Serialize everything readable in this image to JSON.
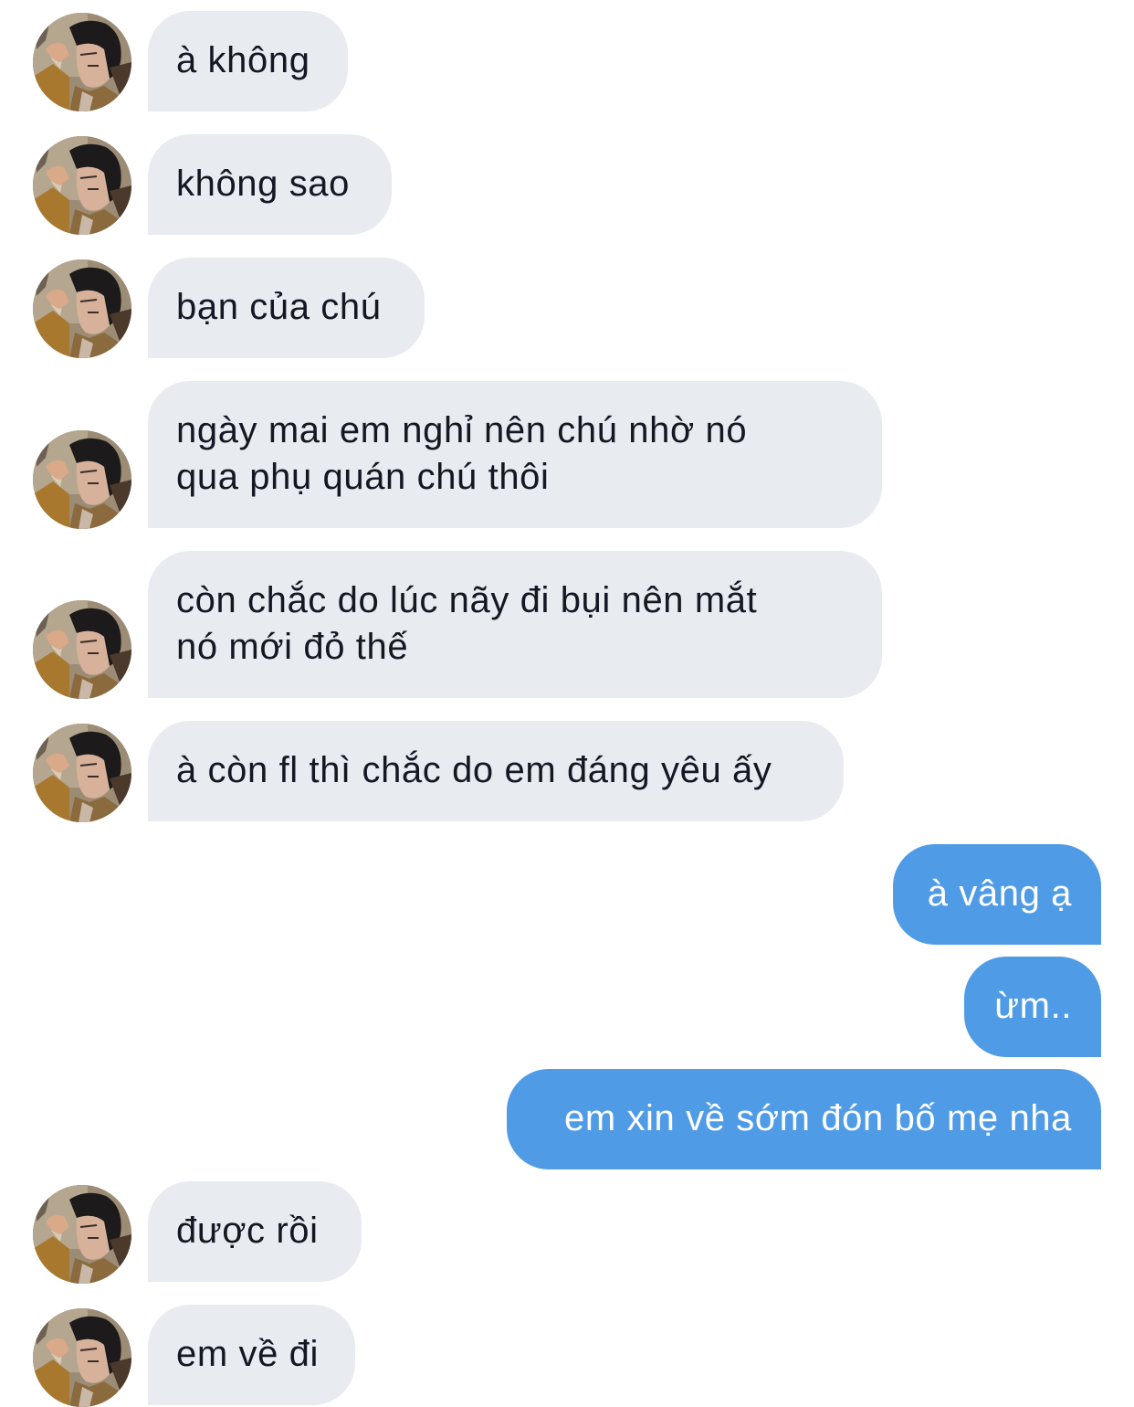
{
  "colors": {
    "incoming_bubble": "#e8ebef",
    "outgoing_bubble": "#4f9be6",
    "incoming_text": "#141823",
    "outgoing_text": "#ffffff"
  },
  "avatar_icon": "contact-avatar-photo",
  "messages": [
    {
      "direction": "incoming",
      "lines": [
        "à không"
      ]
    },
    {
      "direction": "incoming",
      "lines": [
        "không sao"
      ]
    },
    {
      "direction": "incoming",
      "lines": [
        "bạn của chú"
      ]
    },
    {
      "direction": "incoming",
      "lines": [
        "ngày mai em nghỉ nên chú nhờ nó",
        "qua phụ quán chú thôi"
      ]
    },
    {
      "direction": "incoming",
      "lines": [
        "còn chắc do lúc nãy đi bụi nên mắt",
        "nó mới đỏ thế"
      ]
    },
    {
      "direction": "incoming",
      "lines": [
        "à còn fl thì chắc do em đáng yêu ấy"
      ]
    },
    {
      "direction": "outgoing",
      "lines": [
        "à vâng ạ"
      ]
    },
    {
      "direction": "outgoing",
      "lines": [
        "ừm.."
      ]
    },
    {
      "direction": "outgoing",
      "lines": [
        "em xin về sớm đón bố mẹ nha"
      ]
    },
    {
      "direction": "incoming",
      "lines": [
        "được rồi"
      ]
    },
    {
      "direction": "incoming",
      "lines": [
        "em về đi"
      ]
    }
  ]
}
